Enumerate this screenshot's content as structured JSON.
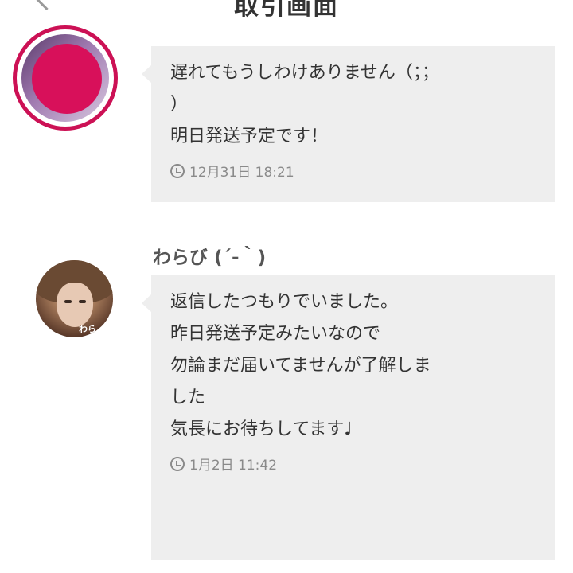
{
  "header": {
    "title": "取引画面"
  },
  "messages": [
    {
      "sender": "",
      "lines": [
        "遅れてもうしわけありません（；；",
        "）",
        "明日発送予定です！"
      ],
      "time": "12月31日 18:21"
    },
    {
      "sender": "わらび (´-｀)",
      "lines": [
        "返信したつもりでいました。",
        "",
        "昨日発送予定みたいなので",
        "勿論まだ届いてませんが了解しま",
        "した",
        "",
        "気長にお待ちしてます♩"
      ],
      "time": "1月2日 11:42"
    }
  ],
  "icons": {
    "back": "chevron-left-icon",
    "clock": "clock-icon"
  },
  "colors": {
    "accent": "#cc1155",
    "bubble": "#eeeeee",
    "meta": "#8a8a8a"
  }
}
